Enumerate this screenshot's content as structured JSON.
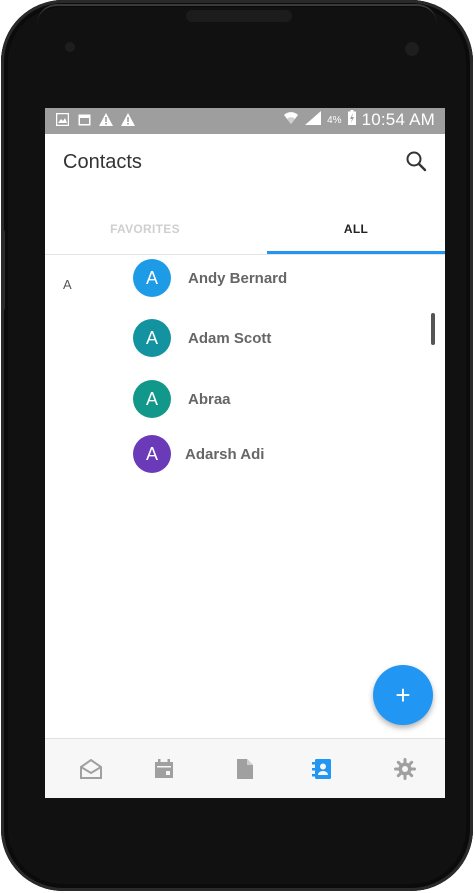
{
  "statusbar": {
    "battery_percent": "4%",
    "time": "10:54 AM",
    "left_icons": [
      "image-icon",
      "calendar-icon",
      "warning-icon",
      "warning-icon"
    ],
    "right_icons": [
      "wifi-icon",
      "signal-icon",
      "battery-charging-icon"
    ]
  },
  "appbar": {
    "title": "Contacts",
    "search_icon": "search-icon"
  },
  "tabs": [
    {
      "label": "FAVORITES",
      "selected": false
    },
    {
      "label": "ALL",
      "selected": true
    }
  ],
  "contacts": {
    "section_letter": "A",
    "items": [
      {
        "initial": "A",
        "name": "Andy Bernard",
        "color": "#1e9be6"
      },
      {
        "initial": "A",
        "name": "Adam Scott",
        "color": "#12939f"
      },
      {
        "initial": "A",
        "name": "Abraa",
        "color": "#12988a"
      },
      {
        "initial": "A",
        "name": "Adarsh Adi",
        "color": "#6b3ab8"
      }
    ]
  },
  "fab": {
    "label": "+"
  },
  "bottom_nav": [
    {
      "icon": "inbox-icon",
      "active": false
    },
    {
      "icon": "calendar-icon",
      "active": false
    },
    {
      "icon": "document-icon",
      "active": false
    },
    {
      "icon": "contacts-icon",
      "active": true
    },
    {
      "icon": "settings-icon",
      "active": false
    }
  ],
  "colors": {
    "accent": "#2196f3",
    "statusbar": "#9e9e9e",
    "inactive_icon": "#a0a0a0"
  }
}
